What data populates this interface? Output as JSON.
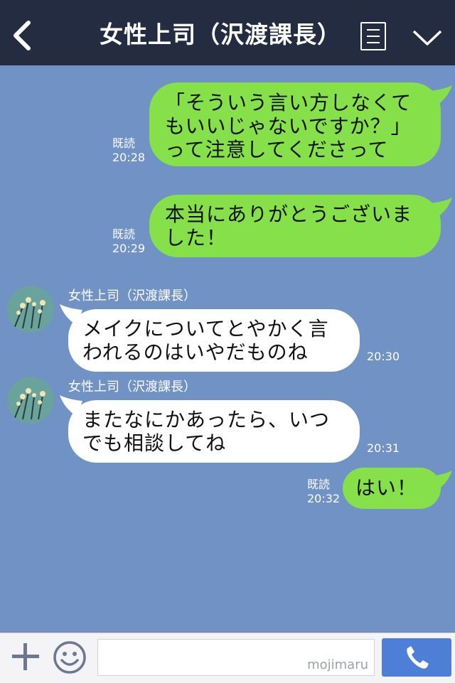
{
  "header": {
    "title": "女性上司（沢渡課長）",
    "back_icon": "chevron-left-icon",
    "menu_icon": "notes-icon",
    "more_icon": "chevron-down-icon",
    "bg_color": "#232c40"
  },
  "chat": {
    "bg_color": "#7092c5",
    "messages": [
      {
        "side": "sent",
        "text": "「そういう言い方しなくて\nもいいじゃないですか？」\nって注意してくださって",
        "read": "既読",
        "time": "20:28"
      },
      {
        "side": "sent",
        "text": "本当にありがとうございま\nした！",
        "read": "既読",
        "time": "20:29"
      },
      {
        "side": "received",
        "sender": "女性上司（沢渡課長）",
        "text": "メイクについてとやかく言\nわれるのはいやだものね",
        "time": "20:30"
      },
      {
        "side": "received",
        "sender": "女性上司（沢渡課長）",
        "text": "またなにかあったら、いつ\nでも相談してね",
        "time": "20:31"
      },
      {
        "side": "sent",
        "text": "はい！",
        "read": "既読",
        "time": "20:32"
      }
    ]
  },
  "footer": {
    "plus_icon": "plus-icon",
    "sticker_icon": "smiley-icon",
    "input_value": "",
    "watermark": "mojimaru",
    "call_icon": "phone-icon",
    "call_color": "#4d7fd6"
  },
  "colors": {
    "sent_bubble": "#86e04a",
    "received_bubble": "#ffffff"
  }
}
